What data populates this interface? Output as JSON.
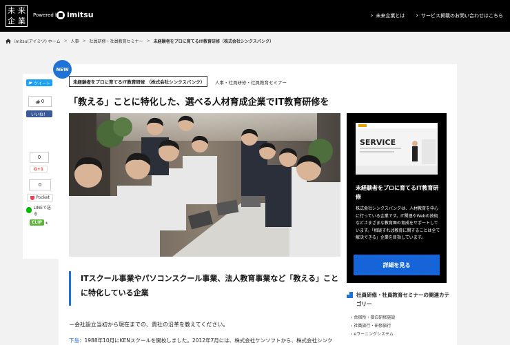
{
  "header": {
    "logo_chars": [
      "未",
      "来",
      "企",
      "業"
    ],
    "powered_by": "Powered by",
    "brand": "imitsu",
    "nav": [
      "未来企業とは",
      "サービス掲載のお問い合わせはこちら"
    ]
  },
  "breadcrumb": {
    "items": [
      "imitsu(アイミツ) ホーム",
      "人事",
      "社員研修・社員教育セミナー"
    ],
    "current": "未経験者をプロに育てるIT教育研修（株式会社シンクスバンク）"
  },
  "share": {
    "tweet": "ツイート",
    "like_count": "0",
    "facebook": "いいね！",
    "gplus_count": "0",
    "gplus": "G+1",
    "pocket_count": "0",
    "pocket": "Pocket",
    "line": "LINEで送る",
    "clip": "CLIP"
  },
  "article": {
    "badge": "NEW",
    "tag": "未経験者をプロに育てるIT教育研修 （株式会社シンクスバンク）",
    "categories": "人事・社員研修・社員教育セミナー",
    "title": "「教える」ことに特化した、選べる人材育成企業でIT教育研修を",
    "subheading": "ITスクール事業やパソコンスクール事業、法人教育事業など「教える」ことに特化している企業",
    "intro": "－会社設立当初から現在までの、貴社の沿革を教えてください。",
    "answer_speaker": "下島",
    "answer_text": "：1988年10月にKENスクールを開校しました。2012年7月には、株式会社ケンソフトから、株式会社シンク"
  },
  "ad": {
    "thumb_label": "SERVICE",
    "title": "未経験者をプロに育てるIT教育研修",
    "description": "株式会社シンクスバンクは、人材教育を中心に行っている企業です。IT関連やWebの技術などさまざまな教育面の育成をサポートしています。「相談すれば教育に関することは全て解決できる」企業を目指しています。",
    "button": "詳細を見る"
  },
  "related": {
    "title": "社員研修・社員教育セミナーの関連カテゴリー",
    "items": [
      "合宿所・宿泊研修施設",
      "社員旅行・研修旅行",
      "eラーニングシステム"
    ]
  },
  "colors": {
    "header_bg": "#000000",
    "accent": "#1f73d6",
    "ad_button": "#1565d8",
    "twitter": "#1da1f2",
    "facebook": "#3b5998",
    "line": "#00b900"
  }
}
